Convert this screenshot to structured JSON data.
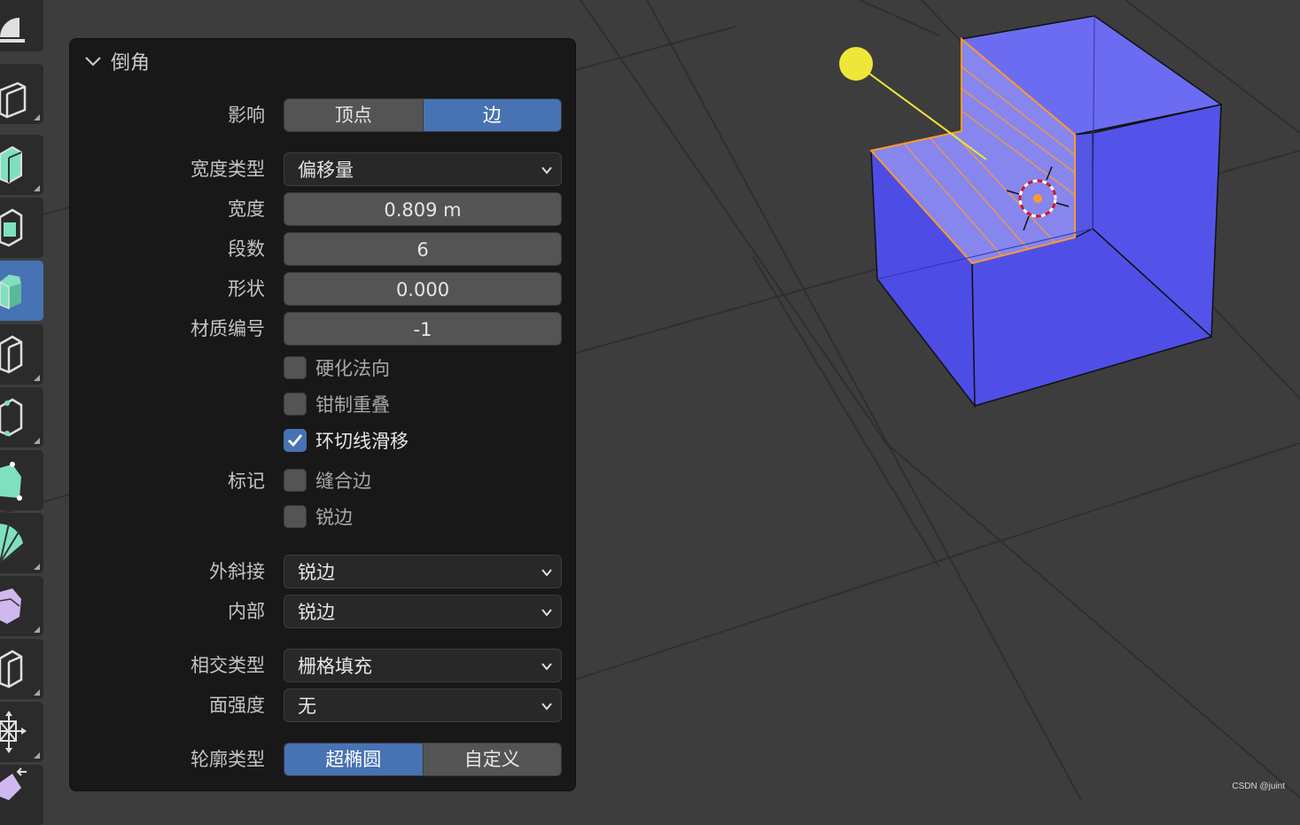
{
  "panel": {
    "title": "倒角",
    "affect": {
      "label": "影响",
      "options": [
        "顶点",
        "边"
      ],
      "selected": "边"
    },
    "width_type": {
      "label": "宽度类型",
      "value": "偏移量"
    },
    "width": {
      "label": "宽度",
      "value": "0.809 m"
    },
    "segments": {
      "label": "段数",
      "value": "6"
    },
    "shape": {
      "label": "形状",
      "value": "0.000"
    },
    "material_index": {
      "label": "材质编号",
      "value": "-1"
    },
    "harden_normals": {
      "label": "硬化法向",
      "checked": false
    },
    "clamp_overlap": {
      "label": "钳制重叠",
      "checked": false
    },
    "loop_slide": {
      "label": "环切线滑移",
      "checked": true
    },
    "mark": {
      "label": "标记",
      "seam": {
        "label": "缝合边",
        "checked": false
      },
      "sharp": {
        "label": "锐边",
        "checked": false
      }
    },
    "miter_outer": {
      "label": "外斜接",
      "value": "锐边"
    },
    "miter_inner": {
      "label": "内部",
      "value": "锐边"
    },
    "intersection_type": {
      "label": "相交类型",
      "value": "栅格填充"
    },
    "face_strength": {
      "label": "面强度",
      "value": "无"
    },
    "profile_type": {
      "label": "轮廓类型",
      "options": [
        "超椭圆",
        "自定义"
      ],
      "selected": "超椭圆"
    }
  },
  "toolbar": {
    "tools": [
      "measure-tool-icon",
      "add-cube-tool-icon",
      "extrude-region-tool-icon",
      "inset-faces-tool-icon",
      "bevel-tool-icon",
      "loop-cut-tool-icon",
      "knife-tool-icon",
      "poly-build-tool-icon",
      "spin-tool-icon",
      "smooth-tool-icon",
      "edge-slide-tool-icon",
      "shrink-fatten-tool-icon",
      "shear-tool-icon"
    ],
    "active": "bevel-tool-icon"
  },
  "colors": {
    "accent": "#4772b3",
    "mesh_face": "#5a5ae6",
    "selection": "#ff9a2e",
    "light": "#f0e63a"
  },
  "watermark": "CSDN @juint"
}
